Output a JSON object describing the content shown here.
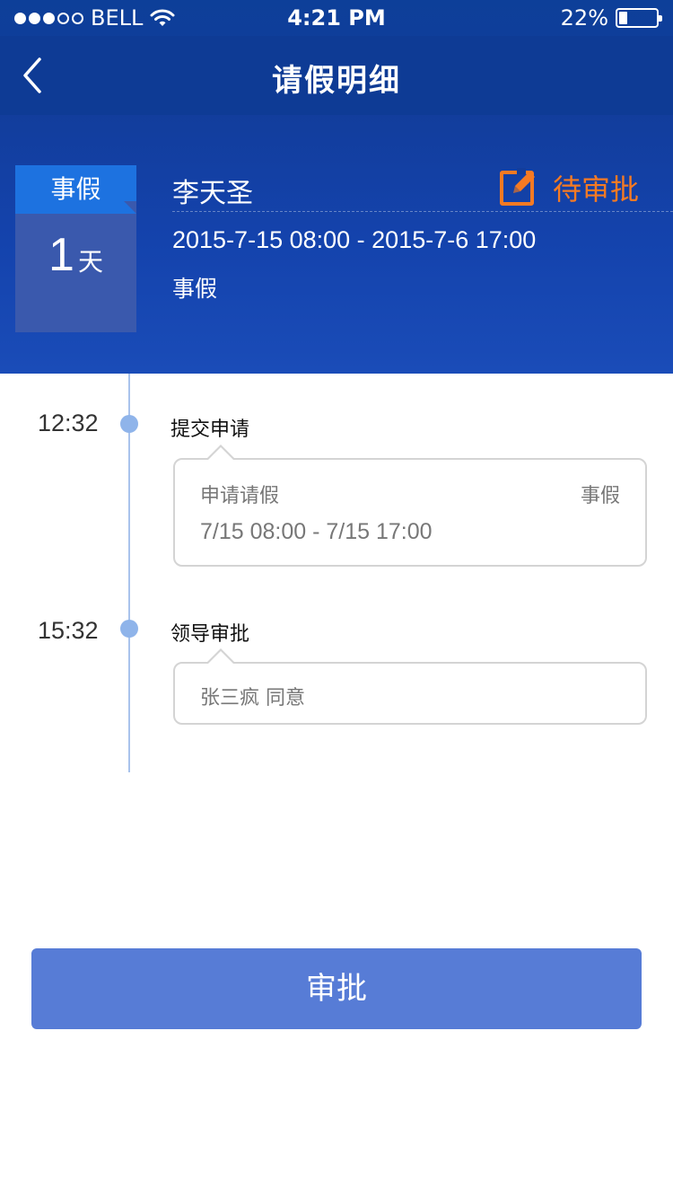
{
  "status_bar": {
    "carrier": "BELL",
    "time": "4:21 PM",
    "battery_percent": "22%",
    "battery_level": 0.22,
    "signal_bars_filled": 3,
    "signal_bars_total": 5
  },
  "nav": {
    "title": "请假明细",
    "back_icon": "chevron-left-icon"
  },
  "leave": {
    "type_label": "事假",
    "days": "1",
    "days_unit": "天",
    "applicant": "李天圣",
    "status": "待审批",
    "status_color": "#f57a23",
    "status_icon": "edit-icon",
    "period": "2015-7-15 08:00 - 2015-7-6 17:00",
    "leave_type": "事假"
  },
  "timeline": [
    {
      "time": "12:32",
      "title": "提交申请",
      "detail_label": "申请请假",
      "detail_type": "事假",
      "detail_period": "7/15 08:00 - 7/15 17:00"
    },
    {
      "time": "15:32",
      "title": "领导审批",
      "detail_text": "张三疯 同意"
    }
  ],
  "actions": {
    "approve_label": "审批",
    "approve_color": "#577cd6"
  },
  "colors": {
    "header_blue": "#123d9c",
    "type_header": "#1d72e0",
    "timeline": "#8fb4ea"
  }
}
